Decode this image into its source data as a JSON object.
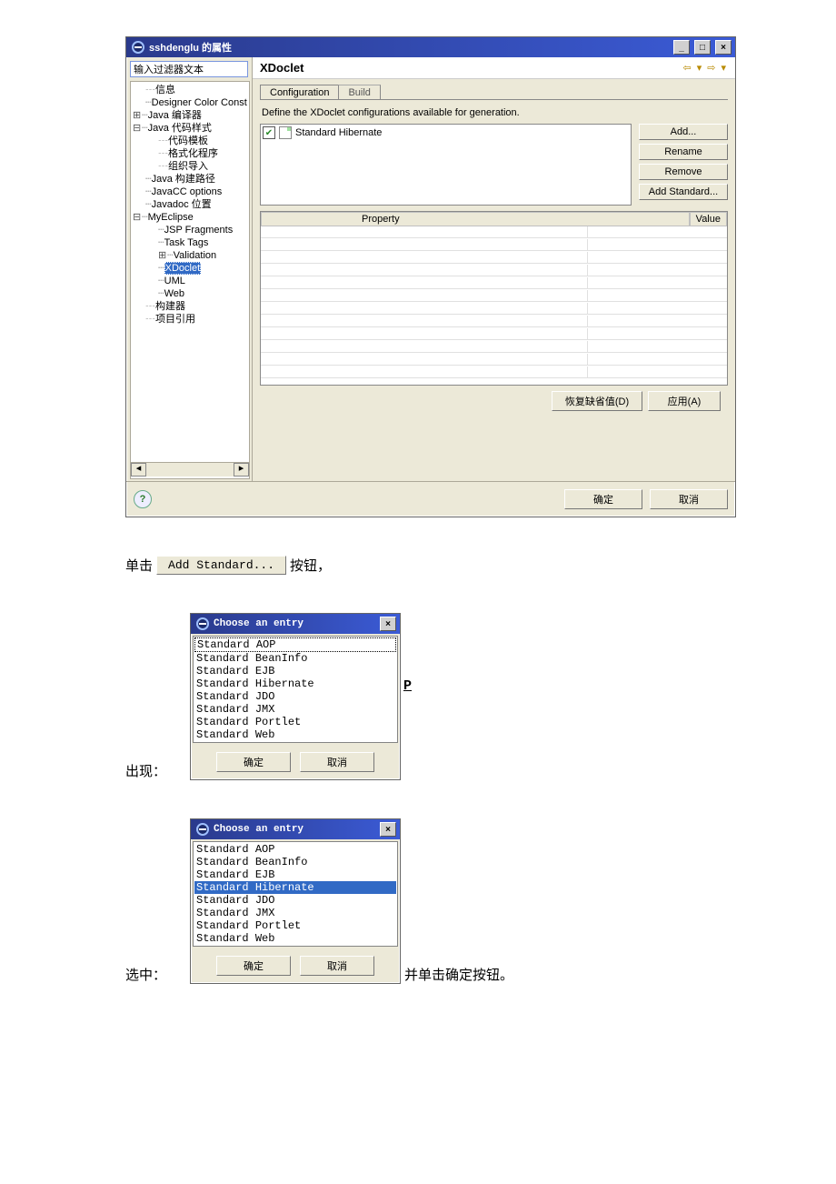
{
  "props": {
    "window_title": "sshdenglu 的属性",
    "filter_placeholder": "输入过滤器文本",
    "heading": "XDoclet",
    "nav_back": "⇦",
    "nav_dd1": "▾",
    "nav_fwd": "⇨",
    "nav_dd2": "▾",
    "tree": {
      "n0": "信息",
      "n1": "Designer Color Const",
      "n2": "Java 编译器",
      "n3": "Java 代码样式",
      "n3a": "代码模板",
      "n3b": "格式化程序",
      "n3c": "组织导入",
      "n4": "Java 构建路径",
      "n5": "JavaCC options",
      "n6": "Javadoc 位置",
      "n7": "MyEclipse",
      "n7a": "JSP Fragments",
      "n7b": "Task Tags",
      "n7c": "Validation",
      "n7d": "XDoclet",
      "n7e": "UML",
      "n7f": "Web",
      "n8": "构建器",
      "n9": "项目引用",
      "scroll_left": "◂",
      "scroll_right": "▸"
    },
    "tab_config": "Configuration",
    "tab_build": "Build",
    "desc": "Define the XDoclet configurations available for generation.",
    "cfg_item": "Standard Hibernate",
    "btn_add": "Add...",
    "btn_rename": "Rename",
    "btn_remove": "Remove",
    "btn_add_std": "Add Standard...",
    "pv_col1": "Property",
    "pv_col2": "Value",
    "btn_restore": "恢复缺省值(D)",
    "btn_apply": "应用(A)",
    "btn_ok": "确定",
    "btn_cancel": "取消",
    "help": "?"
  },
  "line1": {
    "pre": "单击",
    "btn": "Add Standard...",
    "post": "按钮，"
  },
  "choose": {
    "title": "Choose an entry",
    "items": {
      "i0": "Standard AOP",
      "i1": "Standard BeanInfo",
      "i2": "Standard EJB",
      "i3": "Standard Hibernate",
      "i4": "Standard JDO",
      "i5": "Standard JMX",
      "i6": "Standard Portlet",
      "i7": "Standard Web"
    },
    "ok": "确定",
    "cancel": "取消"
  },
  "line2": {
    "pre": "出现："
  },
  "line3": {
    "pre": "选中：",
    "post": "并单击确定按钮。"
  }
}
